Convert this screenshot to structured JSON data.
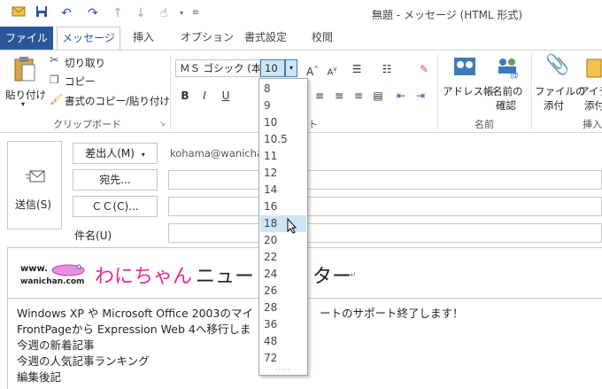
{
  "window": {
    "title": "無題 - メッセージ (HTML 形式)"
  },
  "qat": {
    "icons": [
      "envelope-icon",
      "save-icon",
      "undo-icon",
      "redo-icon",
      "up-arrow-icon",
      "down-arrow-icon",
      "touch-mode-icon",
      "customize-icon"
    ]
  },
  "tabs": [
    {
      "label": "ファイル"
    },
    {
      "label": "メッセージ"
    },
    {
      "label": "挿入"
    },
    {
      "label": "オプション"
    },
    {
      "label": "書式設定"
    },
    {
      "label": "校閲"
    }
  ],
  "ribbon": {
    "paste_label": "貼り付け",
    "cut_label": "切り取り",
    "copy_label": "コピー",
    "format_painter_label": "書式のコピー/貼り付け",
    "clipboard_group": "クリップボード",
    "font_name": "ＭＳ ゴシック (本",
    "font_size": "10",
    "basic_text_group_partial": "ト",
    "address_book_label": "アドレス帳",
    "check_names_label_1": "名前の",
    "check_names_label_2": "確認",
    "names_group": "名前",
    "attach_file_label_1": "ファイルの",
    "attach_file_label_2": "添付",
    "attach_item_label_1": "アイテ",
    "attach_item_label_2": "添付",
    "include_group_partial": "挿入",
    "bold": "B",
    "italic": "I",
    "underline": "U"
  },
  "compose": {
    "send_label": "送信(S)",
    "from_label": "差出人(M)",
    "from_value": "kohama@wanicha",
    "to_label": "宛先...",
    "cc_label": "ＣＣ(C)...",
    "subject_label": "件名(U)"
  },
  "body": {
    "logo_text_top": "www.",
    "logo_text_bottom": "wanichan.com",
    "heading_pink": "わにちゃん",
    "heading_black": "ニュー",
    "heading_tail": "ター",
    "lines": [
      "Windows XP や Microsoft Office 2003のマイ",
      "FrontPageから Expression Web 4へ移行しま",
      "今週の新着記事",
      "今週の人気記事ランキング",
      "編集後記"
    ],
    "line1_tail": "ートのサポート終了します！"
  },
  "size_dropdown": {
    "options": [
      "8",
      "9",
      "10",
      "10.5",
      "11",
      "12",
      "14",
      "16",
      "18",
      "20",
      "22",
      "24",
      "26",
      "28",
      "36",
      "48",
      "72"
    ],
    "highlighted": "18"
  },
  "colors": {
    "accent": "#2b579a",
    "pink": "#e8279a",
    "highlight": "#cde6f7"
  }
}
